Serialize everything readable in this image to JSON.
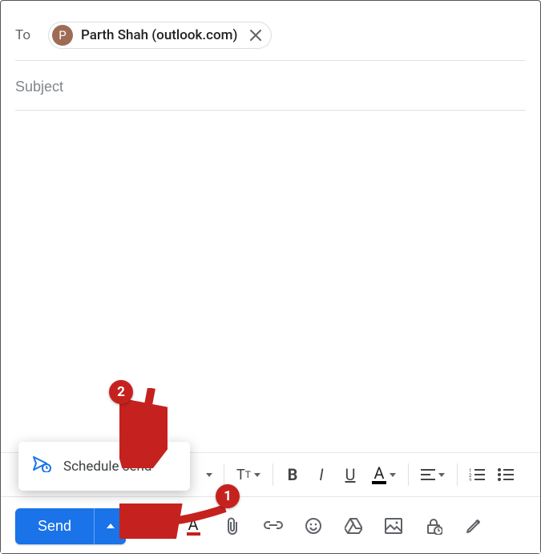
{
  "to": {
    "label": "To",
    "chip": {
      "initial": "P",
      "name": "Parth Shah (outlook.com)"
    }
  },
  "subject": {
    "placeholder": "Subject",
    "value": ""
  },
  "format_toolbar": {
    "font_size": "Tᴛ",
    "bold": "B",
    "italic": "I",
    "underline": "U",
    "text_color": "A"
  },
  "menu": {
    "schedule_send": "Schedule send"
  },
  "send": {
    "label": "Send"
  },
  "bottom_toolbar": {
    "format": "A",
    "attach": "attach",
    "link": "link",
    "emoji": "emoji",
    "drive": "drive",
    "photo": "photo",
    "confidential": "confidential",
    "signature": "signature"
  },
  "annotations": {
    "badge1": "1",
    "badge2": "2"
  }
}
